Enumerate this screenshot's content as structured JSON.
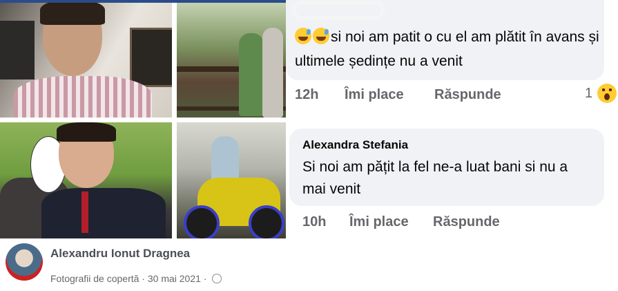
{
  "cover_post": {
    "author_name": "Alexandru Ionut Dragnea",
    "meta_prefix": "Fotografii de copertă",
    "separator": "·",
    "date": "30 mai 2021",
    "privacy_icon": "globe-icon"
  },
  "comments": [
    {
      "text": "si noi am patit o cu el am plătit în avans și ultimele ședințe nu a venit",
      "emojis": [
        "grinning-sweat-emoji",
        "grinning-sweat-emoji"
      ],
      "time": "12h",
      "like_label": "Îmi place",
      "reply_label": "Răspunde",
      "reaction_count": "1",
      "reaction_icon": "wow-icon"
    },
    {
      "author": "Alexandra Stefania",
      "text": "Si noi am pățit la fel ne-a luat bani si nu a mai venit",
      "time": "10h",
      "like_label": "Îmi place",
      "reply_label": "Răspunde"
    }
  ],
  "colors": {
    "bubble": "#f0f2f5",
    "secondary_text": "#65676b",
    "primary_text": "#050505"
  }
}
